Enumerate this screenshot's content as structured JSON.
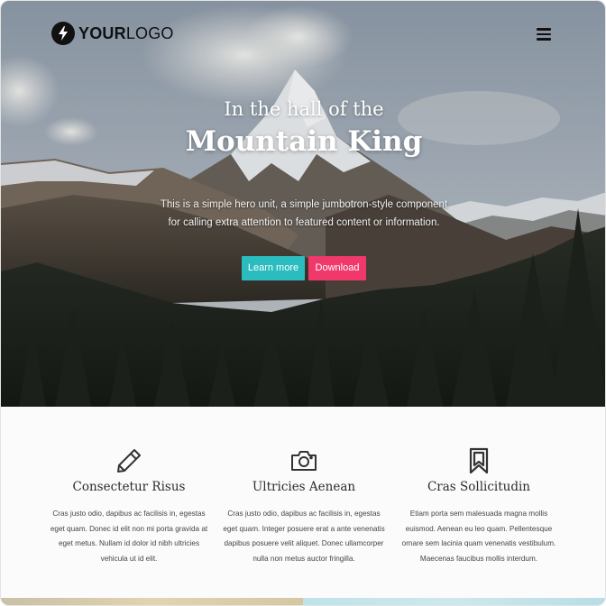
{
  "header": {
    "logo": {
      "bold": "YOUR",
      "regular": "LOGO",
      "icon": "lightning-bolt-icon"
    },
    "menu_icon": "hamburger-menu-icon"
  },
  "hero": {
    "title_line1": "In the hall of the",
    "title_line2": "Mountain King",
    "description": "This is a simple hero unit, a simple jumbotron-style component for calling extra attention to featured content or information.",
    "buttons": {
      "learn_more": "Learn more",
      "download": "Download"
    },
    "colors": {
      "learn_more": "#2bbcbf",
      "download": "#f0386b"
    }
  },
  "features": [
    {
      "icon": "pencil-icon",
      "title": "Consectetur Risus",
      "text": "Cras justo odio, dapibus ac facilisis in, egestas eget quam. Donec id elit non mi porta gravida at eget metus. Nullam id dolor id nibh ultricies vehicula ut id elit."
    },
    {
      "icon": "camera-icon",
      "title": "Ultricies Aenean",
      "text": "Cras justo odio, dapibus ac facilisis in, egestas eget quam. Integer posuere erat a ante venenatis dapibus posuere velit aliquet. Donec ullamcorper nulla non metus auctor fringilla."
    },
    {
      "icon": "bookmark-icon",
      "title": "Cras Sollicitudin",
      "text": "Etiam porta sem malesuada magna mollis euismod. Aenean eu leo quam. Pellentesque ornare sem lacinia quam venenatis vestibulum. Maecenas faucibus mollis interdum."
    }
  ]
}
